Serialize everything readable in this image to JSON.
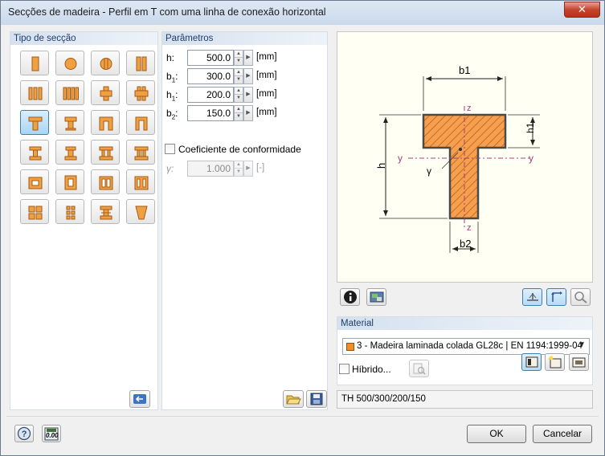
{
  "window": {
    "title": "Secções de madeira - Perfil em T com uma linha de conexão horizontal",
    "close_glyph": "✕"
  },
  "section_type": {
    "header": "Tipo de secção",
    "selected": "t-section",
    "buttons": [
      "rectangle",
      "circle",
      "circle-split",
      "double-rectangle",
      "triple-lamella",
      "quad-lamella",
      "cross-plus",
      "cross-double",
      "t-section",
      "t-section-alt",
      "u-section",
      "u-section-alt",
      "i-section",
      "i-section-alt",
      "double-t-section",
      "double-i-section",
      "box-section",
      "box-section-alt",
      "double-box",
      "triple-box",
      "four-quad",
      "six-grid",
      "i-hatched",
      "tapered"
    ],
    "back_icon": "back-arrow-icon"
  },
  "parameters": {
    "header": "Parâmetros",
    "rows": [
      {
        "label": "h:",
        "value": "500.0",
        "unit": "[mm]"
      },
      {
        "label": "b1:",
        "value": "300.0",
        "unit": "[mm]"
      },
      {
        "label": "h1:",
        "value": "200.0",
        "unit": "[mm]"
      },
      {
        "label": "b2:",
        "value": "150.0",
        "unit": "[mm]"
      }
    ],
    "conformity_checkbox_label": "Coeficiente de conformidade",
    "conformity_checked": false,
    "gamma_label": "γ:",
    "gamma_value": "1.000",
    "gamma_unit": "[-]",
    "open_icon": "folder-open-icon",
    "save_icon": "save-icon"
  },
  "preview": {
    "labels": {
      "b1": "b1",
      "b2": "b2",
      "h": "h",
      "h1": "h1",
      "y_left": "y",
      "y_right": "y",
      "z_top": "z",
      "z_bottom": "z",
      "gamma": "γ"
    },
    "colors": {
      "fill": "#f5a050",
      "hatch": "#c05a10",
      "outline": "#4a4a4a",
      "axis": "#a04080"
    },
    "toolbar_left": [
      "info-icon",
      "render-view-icon"
    ],
    "toolbar_right": [
      "dimension-view-icon",
      "axes-view-icon",
      "measure-tool-icon"
    ]
  },
  "material": {
    "header": "Material",
    "selected_text": "3 - Madeira laminada colada GL28c | EN 1194:1999-04",
    "swatch_color": "#f08f2a",
    "hybrid_label": "Híbrido...",
    "hybrid_checked": false,
    "buttons": [
      "material-library-icon",
      "new-material-icon",
      "edit-material-icon"
    ]
  },
  "summary_text": "TH 500/300/200/150",
  "footer": {
    "help_icon": "help-icon",
    "calculator_text": "0.00",
    "ok_label": "OK",
    "cancel_label": "Cancelar"
  }
}
